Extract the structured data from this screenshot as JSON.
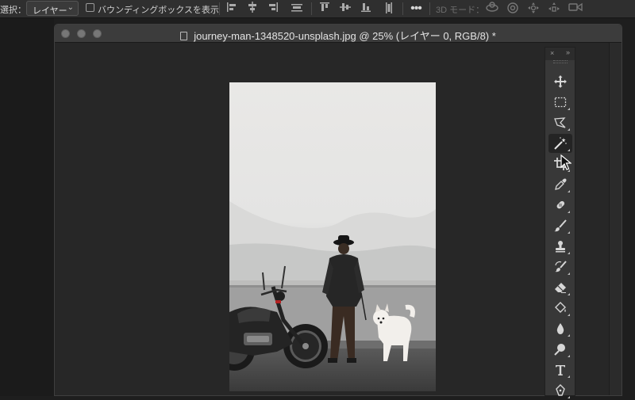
{
  "options_bar": {
    "select_label": "選択：",
    "layer_select_value": "レイヤー",
    "bounding_box_label": "バウンディングボックスを表示",
    "bounding_box_checked": false,
    "mode_3d_label": "3D モード："
  },
  "document": {
    "title": "journey-man-1348520-unsplash.jpg @ 25% (レイヤー 0, RGB/8) *",
    "zoom": "25%"
  },
  "tools_panel": {
    "close_glyph": "×",
    "collapse_glyph": "»",
    "tools": [
      {
        "name": "move-tool",
        "icon": "move-icon",
        "active": false
      },
      {
        "name": "rectangular-marquee-tool",
        "icon": "marquee-icon",
        "active": false
      },
      {
        "name": "lasso-tool",
        "icon": "polygonal-lasso-icon",
        "active": false
      },
      {
        "name": "magic-wand-tool",
        "icon": "magic-wand-icon",
        "active": true
      },
      {
        "name": "crop-tool",
        "icon": "crop-icon",
        "active": false
      },
      {
        "name": "eyedropper-tool",
        "icon": "eyedropper-icon",
        "active": false
      },
      {
        "name": "healing-brush-tool",
        "icon": "bandage-icon",
        "active": false
      },
      {
        "name": "brush-tool",
        "icon": "brush-icon",
        "active": false
      },
      {
        "name": "clone-stamp-tool",
        "icon": "stamp-icon",
        "active": false
      },
      {
        "name": "history-brush-tool",
        "icon": "history-brush-icon",
        "active": false
      },
      {
        "name": "eraser-tool",
        "icon": "eraser-icon",
        "active": false
      },
      {
        "name": "paint-bucket-tool",
        "icon": "paint-bucket-icon",
        "active": false
      },
      {
        "name": "blur-tool",
        "icon": "drop-icon",
        "active": false
      },
      {
        "name": "dodge-tool",
        "icon": "dodge-icon",
        "active": false
      },
      {
        "name": "type-tool",
        "icon": "type-icon",
        "active": false
      },
      {
        "name": "pen-tool",
        "icon": "pen-icon",
        "active": false
      }
    ]
  },
  "colors": {
    "app_background": "#1e1e1e",
    "panel": "#383838",
    "titlebar": "#3c3c3c",
    "icon": "#cfcfcf"
  }
}
